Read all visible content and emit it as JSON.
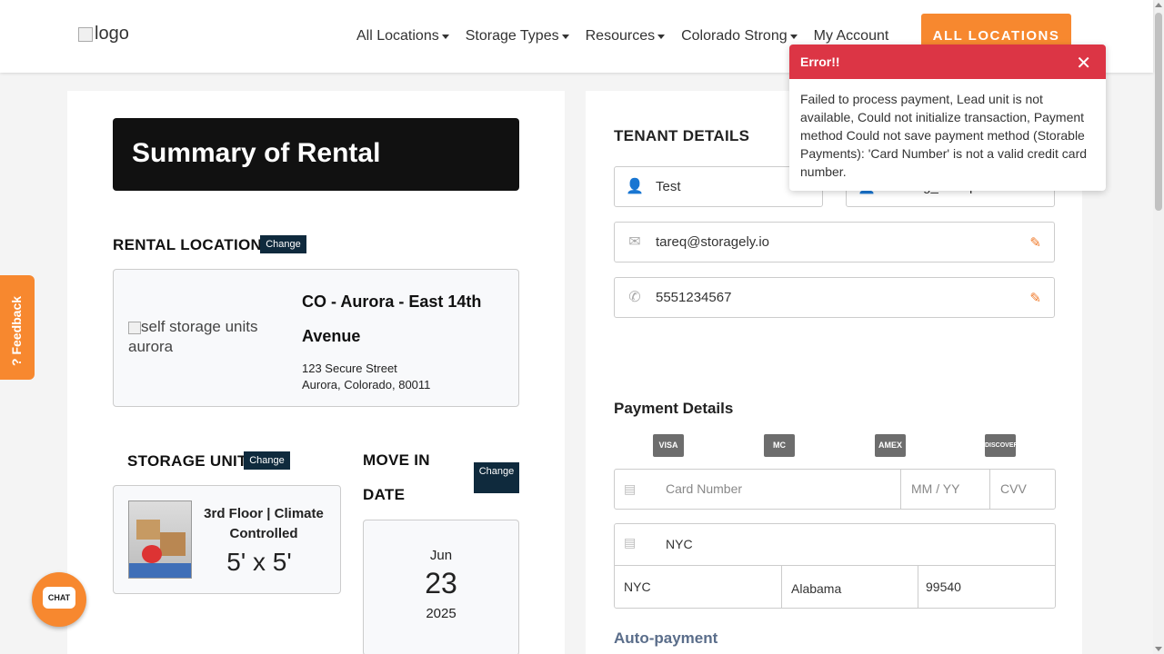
{
  "header": {
    "logo_text": "logo",
    "nav": [
      "All Locations",
      "Storage Types",
      "Resources",
      "Colorado Strong",
      "My Account"
    ],
    "all_locations_button": "ALL LOCATIONS"
  },
  "summary": {
    "title": "Summary of Rental",
    "rental_location_label": "RENTAL LOCATION",
    "change_label": "Change",
    "location": {
      "image_alt": "self storage units aurora",
      "name": "CO - Aurora - East 14th Avenue",
      "street": "123 Secure Street",
      "city": "Aurora, Colorado, 80011"
    },
    "storage_unit_label": "STORAGE UNIT",
    "unit": {
      "name": "3rd Floor | Climate Controlled",
      "size": "5' x 5'"
    },
    "move_in_label": "MOVE IN DATE",
    "move_in": {
      "month": "Jun",
      "day": "23",
      "year": "2025"
    }
  },
  "tenant": {
    "title": "TENANT DETAILS",
    "first_name": "Test",
    "last_name": "Testing_Tareq",
    "email": "tareq@storagely.io",
    "phone": "5551234567"
  },
  "payment": {
    "title": "Payment Details",
    "card_logos": [
      "VISA",
      "MC",
      "AMEX",
      "DISCOVER"
    ],
    "card_number_placeholder": "Card Number",
    "expiry_placeholder": "MM / YY",
    "cvv_placeholder": "CVV",
    "name_on_card": "NYC",
    "city": "NYC",
    "state": "Alabama",
    "zip": "99540",
    "autopay_label": "Auto-payment"
  },
  "feedback_label": "? Feedback",
  "chat_label": "CHAT",
  "toast": {
    "title": "Error!!",
    "message": "Failed to process payment, Lead unit is not available, Could not initialize transaction, Payment method Could not save payment method (Storable Payments): 'Card Number' is not a valid credit card number.",
    "close_symbol": "✕"
  }
}
